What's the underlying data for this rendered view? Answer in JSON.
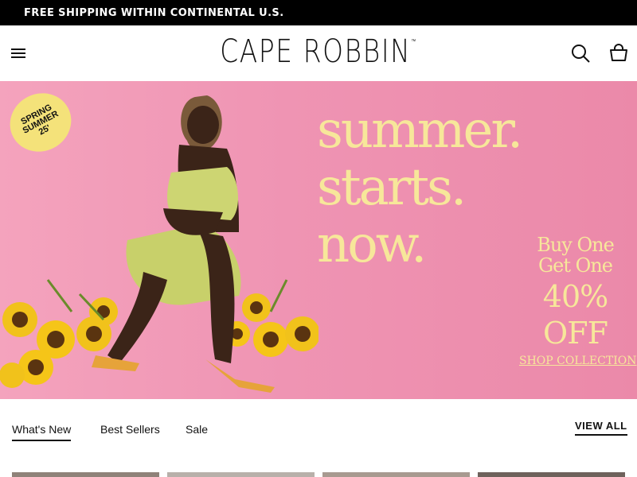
{
  "promo_bar": {
    "text": "FREE SHIPPING WITHIN CONTINENTAL U.S."
  },
  "header": {
    "logo_text": "CAPE ROBBIN",
    "logo_tm": "™"
  },
  "hero": {
    "badge_lines": [
      "SPRING",
      "SUMMER",
      "25'"
    ],
    "headline_lines": [
      "summer.",
      "starts.",
      "now."
    ],
    "offer_lines": [
      "Buy One",
      "Get One",
      "40%",
      "OFF"
    ],
    "cta": "SHOP COLLECTION",
    "colors": {
      "background": "#ef94b3",
      "headline": "#f7e79a",
      "badge": "#f4e27a"
    }
  },
  "product_tabs": {
    "tabs": [
      "What's New",
      "Best Sellers",
      "Sale"
    ],
    "active_tab": "What's New",
    "view_all": "VIEW ALL"
  },
  "icons": [
    "menu-icon",
    "search-icon",
    "shopping-bag-icon"
  ]
}
